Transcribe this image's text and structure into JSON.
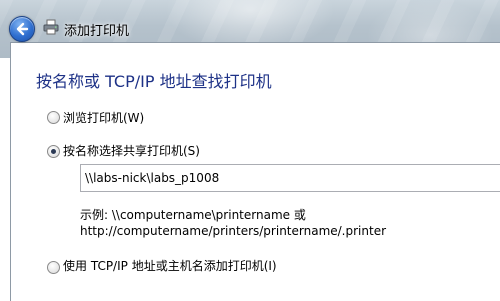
{
  "window": {
    "title": "添加打印机"
  },
  "icons": {
    "back": "back-arrow-icon",
    "printer": "printer-icon"
  },
  "main": {
    "heading": "按名称或 TCP/IP 地址查找打印机",
    "options": [
      {
        "label": "浏览打印机(W)",
        "checked": false
      },
      {
        "label": "按名称选择共享打印机(S)",
        "checked": true
      },
      {
        "label": "使用 TCP/IP 地址或主机名添加打印机(I)",
        "checked": false
      }
    ],
    "shared_printer_path": "\\\\labs-nick\\labs_p1008",
    "example_line1": "示例: \\\\computername\\printername 或",
    "example_line2": "http://computername/printers/printername/.printer"
  },
  "colors": {
    "heading": "#1e3287",
    "back_button": "#2f6fd0"
  }
}
